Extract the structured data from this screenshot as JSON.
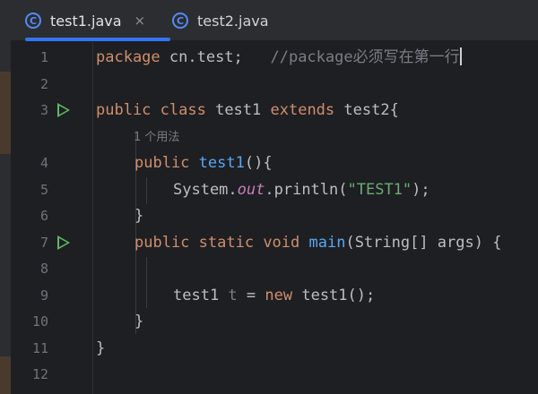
{
  "tabs": [
    {
      "label": "test1.java",
      "icon": "java-class-icon",
      "active": true,
      "close": "×"
    },
    {
      "label": "test2.java",
      "icon": "java-class-icon",
      "active": false
    }
  ],
  "class_icon_letter": "C",
  "code_lines": [
    {
      "n": "1",
      "package_kw": "package",
      "package_name": " cn.test;",
      "comment": "   //package必须写在第一行"
    },
    {
      "n": "2"
    },
    {
      "n": "3",
      "k1": "public",
      "k2": " class",
      "cls": " test1",
      "k3": " extends",
      "parent": " test2{"
    },
    {
      "hint": "1 个用法"
    },
    {
      "n": "4",
      "k1": "public",
      "ctor": " test1",
      "rest": "(){"
    },
    {
      "n": "5",
      "sys": "System.",
      "out": "out",
      "call": ".println(",
      "str": "\"TEST1\"",
      "end": ");"
    },
    {
      "n": "6",
      "brace": "}"
    },
    {
      "n": "7",
      "k1": "public",
      "k2": " static",
      "k3": " void",
      "fn": " main",
      "rest": "(String[] args) {"
    },
    {
      "n": "8"
    },
    {
      "n": "9",
      "t1": "test1",
      "var": " t",
      "eq": " =",
      "kw_new": " new",
      "rest": " test1();"
    },
    {
      "n": "10",
      "brace": "}"
    },
    {
      "n": "11",
      "brace": "}"
    },
    {
      "n": "12"
    }
  ],
  "colors": {
    "keyword": "#cf8e6d",
    "function": "#56a8f5",
    "string": "#6aab73",
    "comment": "#7a7e85",
    "static_field": "#c77dbb",
    "run_icon": "#5fb865",
    "tab_underline": "#3574f0"
  }
}
